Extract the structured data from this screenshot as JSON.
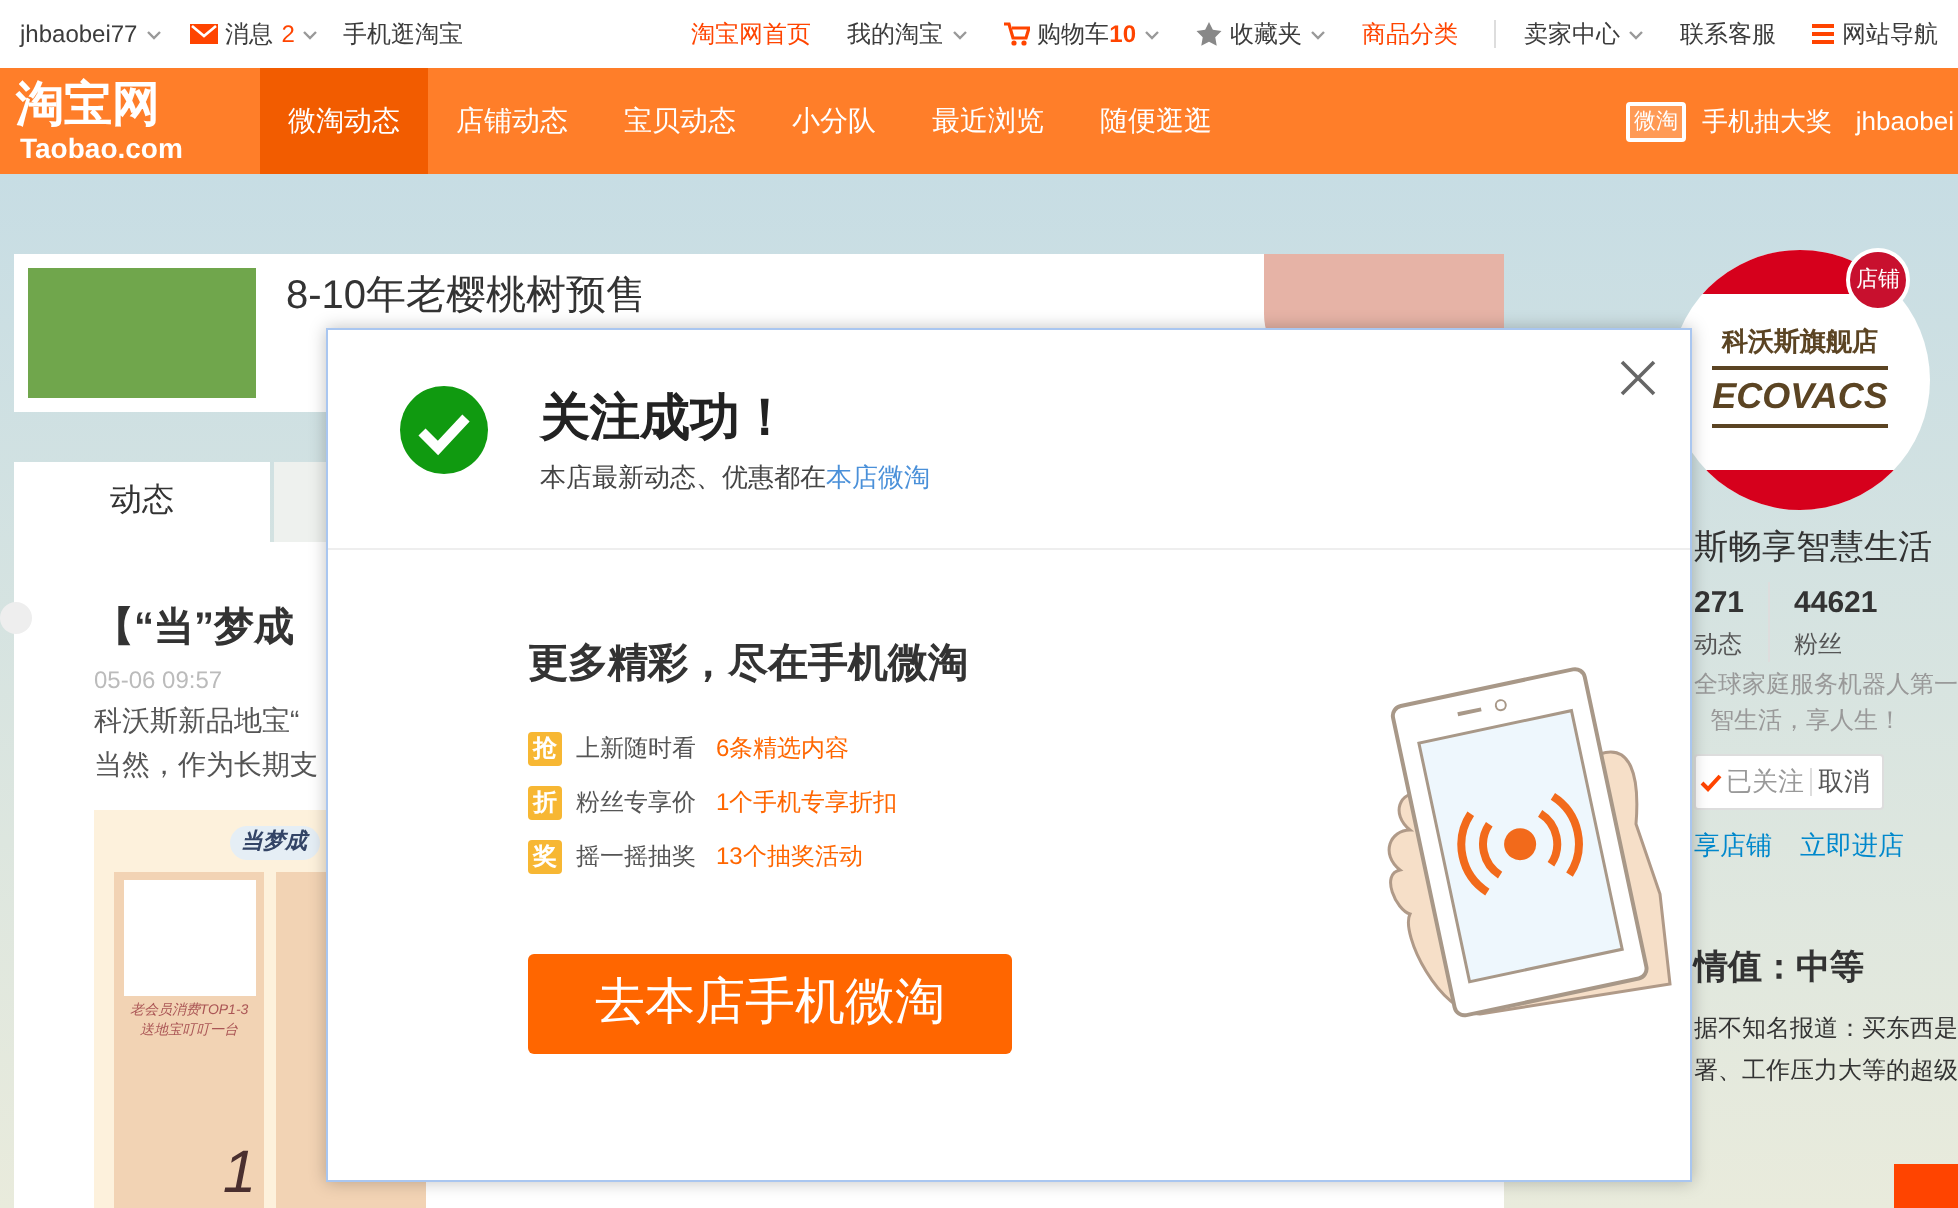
{
  "top_bar": {
    "user": "jhbaobei77",
    "messages_label": "消息",
    "messages_count": "2",
    "mobile": "手机逛淘宝",
    "links": [
      {
        "kind": "red",
        "label": "淘宝网首页"
      },
      {
        "kind": "menu",
        "label": "我的淘宝"
      },
      {
        "kind": "cart",
        "label": "购物车",
        "count": "10"
      },
      {
        "kind": "star",
        "label": "收藏夹"
      },
      {
        "kind": "red",
        "label": "商品分类"
      },
      {
        "kind": "divider_menu",
        "label": "卖家中心"
      },
      {
        "kind": "plain",
        "label": "联系客服"
      },
      {
        "kind": "nav",
        "label": "网站导航"
      }
    ]
  },
  "nav": {
    "logo": "淘宝网",
    "logo_sub": "Taobao.com",
    "tabs": [
      {
        "label": "微淘动态",
        "selected": true
      },
      {
        "label": "店铺动态",
        "selected": false
      },
      {
        "label": "宝贝动态",
        "selected": false
      },
      {
        "label": "小分队",
        "selected": false
      },
      {
        "label": "最近浏览",
        "selected": false
      },
      {
        "label": "随便逛逛",
        "selected": false
      }
    ],
    "badge": "微淘",
    "promo": "手机抽大奖",
    "user": "jhbaobei"
  },
  "banner": {
    "text": "8-10年老樱桃树预售"
  },
  "feed": {
    "tab": "动态",
    "post_title": "【“当”梦成",
    "time": "05-06 09:57",
    "text_lines": [
      "科沃斯新品地宝“",
      "当然，作为长期支"
    ],
    "image_tag": "当梦成",
    "cards": [
      {
        "caption": "老会员消费TOP1-3 送地宝叮叮一台",
        "rank": "1"
      }
    ]
  },
  "profile": {
    "store_badge": "店铺",
    "logo_text": "科沃斯旗舰店",
    "logo_brand": "ECOVACS",
    "name": "斯畅享智慧生活",
    "stats": [
      {
        "value": "271",
        "label": "动态"
      },
      {
        "value": "44621",
        "label": "粉丝"
      }
    ],
    "bio_lines": [
      "全球家庭服务机器人第一",
      "智生活，享人生！"
    ],
    "followed": "已关注",
    "unfollow": "取消",
    "links": [
      "享店铺",
      "立即进店"
    ],
    "rating_title": "情值：中等",
    "rating_lines": [
      "据不知名报道：买东西是",
      "署、工作压力大等的超级"
    ]
  },
  "dialog": {
    "title": "关注成功！",
    "subtitle": "本店最新动态、优惠都在",
    "subtitle_link": "本店微淘",
    "headline": "更多精彩，尽在手机微淘",
    "perks": [
      {
        "badge": "抢",
        "label": "上新随时看",
        "value": "6条精选内容"
      },
      {
        "badge": "折",
        "label": "粉丝专享价",
        "value": "1个手机专享折扣"
      },
      {
        "badge": "奖",
        "label": "摇一摇抽奖",
        "value": "13个抽奖活动"
      }
    ],
    "button": "去本店手机微淘"
  }
}
